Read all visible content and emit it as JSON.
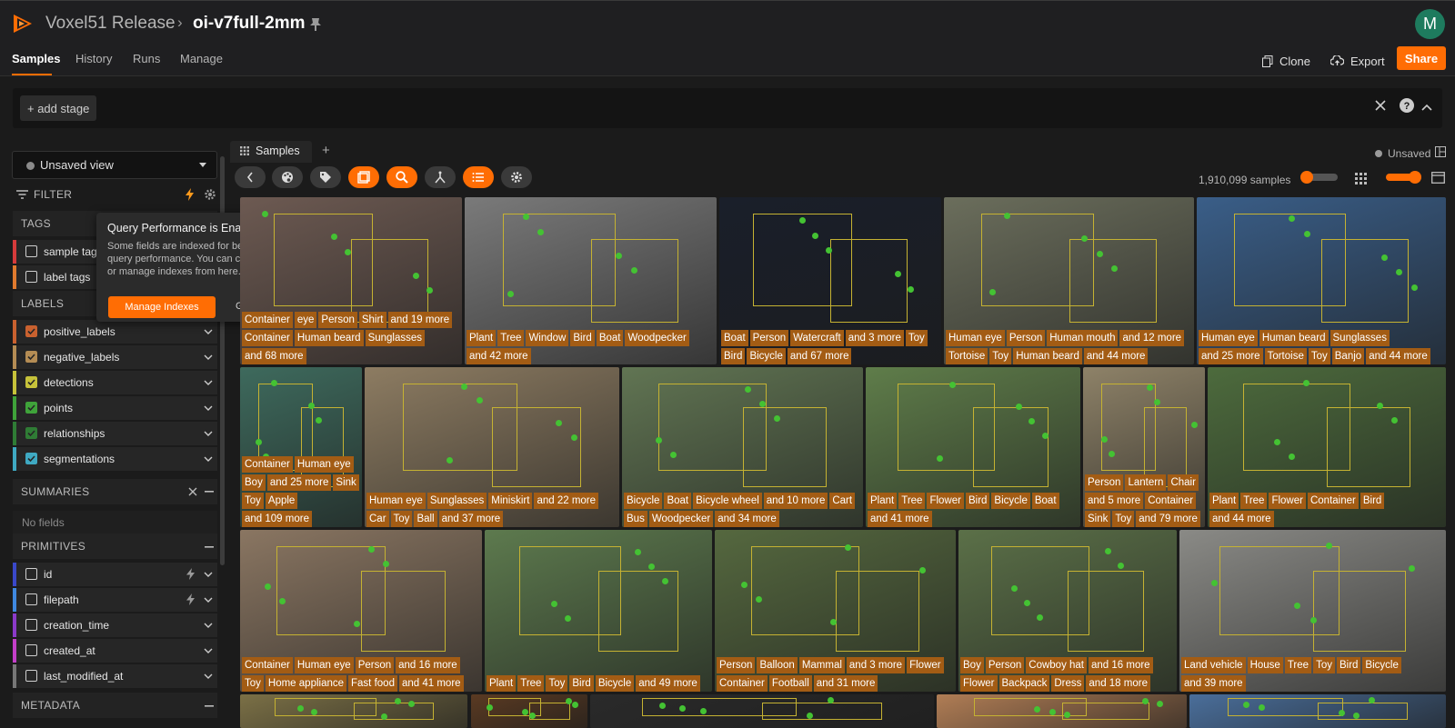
{
  "header": {
    "app_name": "Voxel51 Release",
    "breadcrumb_separator": "›",
    "dataset_name": "oi-v7full-2mm",
    "user_initial": "M",
    "accent_color": "#ff6d04"
  },
  "nav": {
    "tabs": [
      "Samples",
      "History",
      "Runs",
      "Manage"
    ],
    "clone_label": "Clone",
    "export_label": "Export",
    "share_label": "Share"
  },
  "viewbar": {
    "add_stage_label": "+ add stage"
  },
  "sidebar": {
    "view_select": "Unsaved view",
    "filter_label": "FILTER",
    "sections": {
      "tags": "TAGS",
      "labels": "LABELS",
      "summaries": "SUMMARIES",
      "primitives": "PRIMITIVES",
      "metadata": "METADATA"
    },
    "tag_fields": [
      {
        "label": "sample tags",
        "color": "#d63b3b",
        "checked": false
      },
      {
        "label": "label tags",
        "color": "#e07a2e",
        "checked": false
      }
    ],
    "label_fields": [
      {
        "label": "positive_labels",
        "color": "#c9612f",
        "checked": true
      },
      {
        "label": "negative_labels",
        "color": "#b48c54",
        "checked": true
      },
      {
        "label": "detections",
        "color": "#c6c23a",
        "checked": true
      },
      {
        "label": "points",
        "color": "#3fa33a",
        "checked": true
      },
      {
        "label": "relationships",
        "color": "#2f7c35",
        "checked": true
      },
      {
        "label": "segmentations",
        "color": "#3fa9c2",
        "checked": true
      }
    ],
    "no_fields": "No fields",
    "primitive_fields": [
      {
        "label": "id",
        "color": "#3a48c9",
        "checked": false,
        "indexed": true
      },
      {
        "label": "filepath",
        "color": "#3f88e0",
        "checked": false,
        "indexed": true
      },
      {
        "label": "creation_time",
        "color": "#8b3ac9",
        "checked": false,
        "indexed": false
      },
      {
        "label": "created_at",
        "color": "#c43fc9",
        "checked": false,
        "indexed": false
      },
      {
        "label": "last_modified_at",
        "color": "#777777",
        "checked": false,
        "indexed": false
      }
    ]
  },
  "tooltip": {
    "title": "Query Performance is Enabled",
    "body": "Some fields are indexed for better query performance. You can create or manage indexes from here.",
    "primary_button": "Manage Indexes",
    "secondary_button": "Got it"
  },
  "main": {
    "tab_label": "Samples",
    "unsaved_label": "Unsaved",
    "sample_count": "1,910,099 samples"
  },
  "grid": [
    {
      "bg": "#6d5a52",
      "labels": [
        "Container",
        "eye",
        "Person",
        "Shirt",
        "and 19 more",
        "",
        "Container",
        "Human beard",
        "Sunglasses",
        "and 68 more"
      ]
    },
    {
      "bg": "#7a7a7a",
      "labels": [
        "Plant",
        "Tree",
        "Window",
        "Bird",
        "Boat",
        "Woodpecker",
        "and 42 more"
      ]
    },
    {
      "bg": "#1a1f2a",
      "labels": [
        "Boat",
        "Person",
        "Watercraft",
        "and 3 more",
        "Toy",
        "Bird",
        "Bicycle",
        "and 67 more"
      ]
    },
    {
      "bg": "#6b6e5c",
      "labels": [
        "Human eye",
        "Person",
        "Human mouth",
        "and 12 more",
        "Tortoise",
        "Toy",
        "Human beard",
        "and 44 more"
      ]
    },
    {
      "bg": "#3a5e88",
      "labels": [
        "Human eye",
        "Human beard",
        "Sunglasses",
        "and 25 more",
        "Tortoise",
        "Toy",
        "Banjo",
        "and 44 more"
      ]
    },
    {
      "bg": "#3e6a5d",
      "labels": [
        "Container",
        "Human eye",
        "Boy",
        "and 25 more",
        "Sink",
        "Toy",
        "Apple",
        "and 109 more"
      ]
    },
    {
      "bg": "#8d7c62",
      "labels": [
        "Human eye",
        "Sunglasses",
        "Miniskirt",
        "and 22 more",
        "Car",
        "Toy",
        "Ball",
        "and 37 more"
      ]
    },
    {
      "bg": "#617553",
      "labels": [
        "Bicycle",
        "Boat",
        "Bicycle wheel",
        "and 10 more",
        "Cart",
        "Bus",
        "Woodpecker",
        "and 34 more"
      ]
    },
    {
      "bg": "#5f7d4a",
      "labels": [
        "Plant",
        "Tree",
        "Flower",
        "Bird",
        "Bicycle",
        "Boat",
        "and 41 more"
      ]
    },
    {
      "bg": "#8e8268",
      "labels": [
        "Person",
        "Lantern",
        "Chair",
        "and 5 more",
        "Container",
        "Sink",
        "Toy",
        "and 79 more"
      ]
    },
    {
      "bg": "#4d6b3d",
      "labels": [
        "Plant",
        "Tree",
        "Flower",
        "Container",
        "Bird",
        "and 44 more"
      ]
    },
    {
      "bg": "#8a7662",
      "labels": [
        "Container",
        "Human eye",
        "Person",
        "and 16 more",
        "Toy",
        "Home appliance",
        "Fast food",
        "and 41 more"
      ]
    },
    {
      "bg": "#5d7a4e",
      "labels": [
        "Plant",
        "Tree",
        "Toy",
        "Bird",
        "Bicycle",
        "and 49 more"
      ]
    },
    {
      "bg": "#55683f",
      "labels": [
        "Person",
        "Balloon",
        "Mammal",
        "and 3 more",
        "Flower",
        "Container",
        "Football",
        "and 31 more"
      ]
    },
    {
      "bg": "#5b7048",
      "labels": [
        "Boy",
        "Person",
        "Cowboy hat",
        "and 16 more",
        "Flower",
        "Backpack",
        "Dress",
        "and 18 more"
      ]
    },
    {
      "bg": "#8a8a86",
      "labels": [
        "Land vehicle",
        "House",
        "Tree",
        "Toy",
        "Bird",
        "Bicycle",
        "and 39 more"
      ]
    }
  ]
}
